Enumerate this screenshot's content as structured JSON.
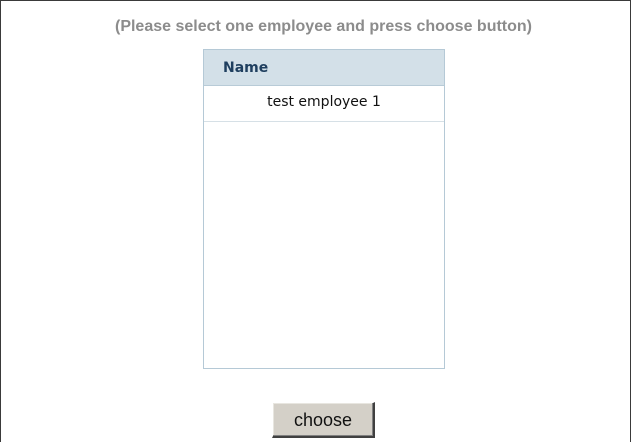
{
  "instruction": "(Please select one employee and press choose button)",
  "employee_grid": {
    "column_header": "Name",
    "rows": [
      {
        "name": "test employee 1"
      }
    ]
  },
  "actions": {
    "choose_label": "choose"
  },
  "colors": {
    "instruction_text": "#8c8c8c",
    "header_background": "#d3e0e8",
    "header_text": "#1f3f5f",
    "grid_border": "#b5c9d6",
    "button_face": "#d4d0c8"
  }
}
